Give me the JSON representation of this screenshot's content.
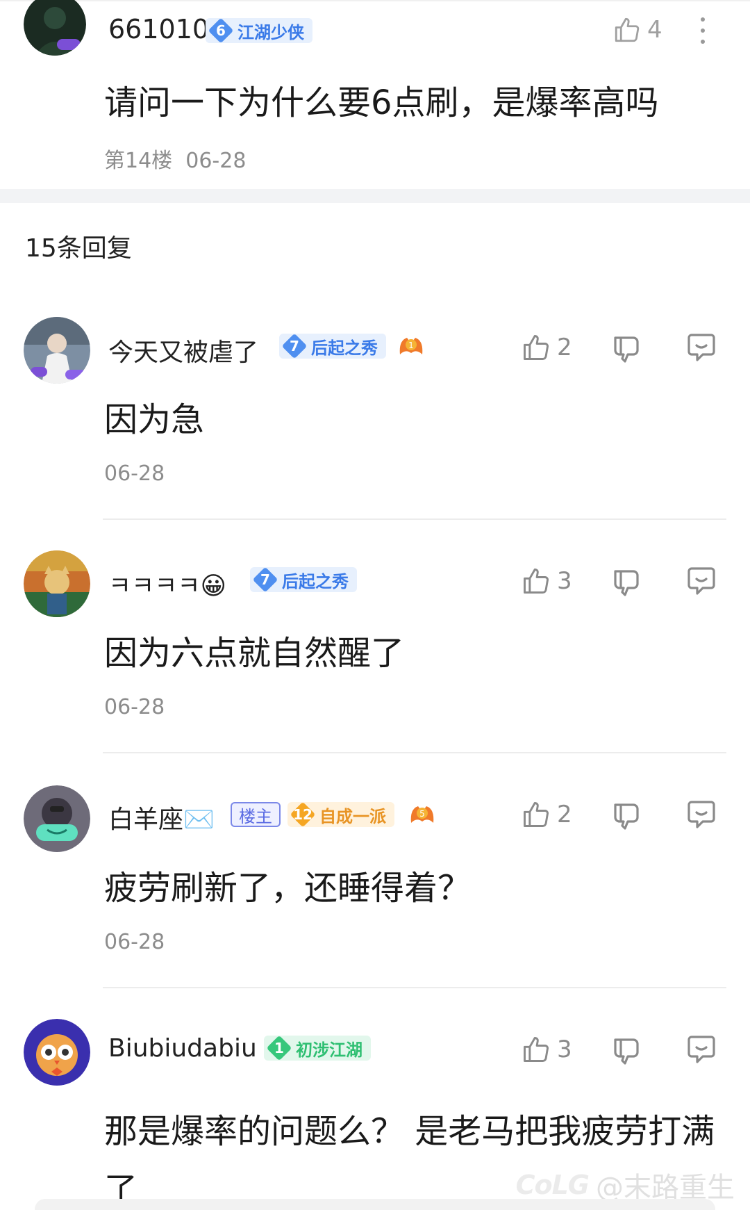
{
  "post": {
    "username": "661010",
    "level": "6",
    "level_title": "江湖少侠",
    "like_count": "4",
    "content": "请问一下为什么要6点刷，是爆率高吗",
    "floor_meta": "第14楼  06-28"
  },
  "replies_header": "15条回复",
  "replies": [
    {
      "username": "今天又被虐了",
      "level": "7",
      "level_title": "后起之秀",
      "like_count": "2",
      "content": "因为急",
      "date": "06-28"
    },
    {
      "username": "ㅋㅋㅋㅋ😀",
      "level": "7",
      "level_title": "后起之秀",
      "like_count": "3",
      "content": "因为六点就自然醒了",
      "date": "06-28"
    },
    {
      "username": "白羊座✉️",
      "owner_tag": "楼主",
      "level": "12",
      "level_title": "自成一派",
      "like_count": "2",
      "content": "疲劳刷新了，还睡得着？",
      "date": "06-28"
    },
    {
      "username": "Biubiudabiu",
      "level": "1",
      "level_title": "初涉江湖",
      "like_count": "3",
      "content": "那是爆率的问题么？ 是老马把我疲劳打满了"
    }
  ],
  "watermark": {
    "logo": "CoLG",
    "text": "@末路重生"
  },
  "colors": {
    "badge_blue": "#4f8ff0",
    "badge_orange": "#f5a623",
    "badge_green": "#36c77b",
    "meta_gray": "#8c8c8c"
  },
  "icons": [
    "thumb-up-icon",
    "thumb-down-icon",
    "reply-icon",
    "more-icon",
    "medal-icon"
  ]
}
